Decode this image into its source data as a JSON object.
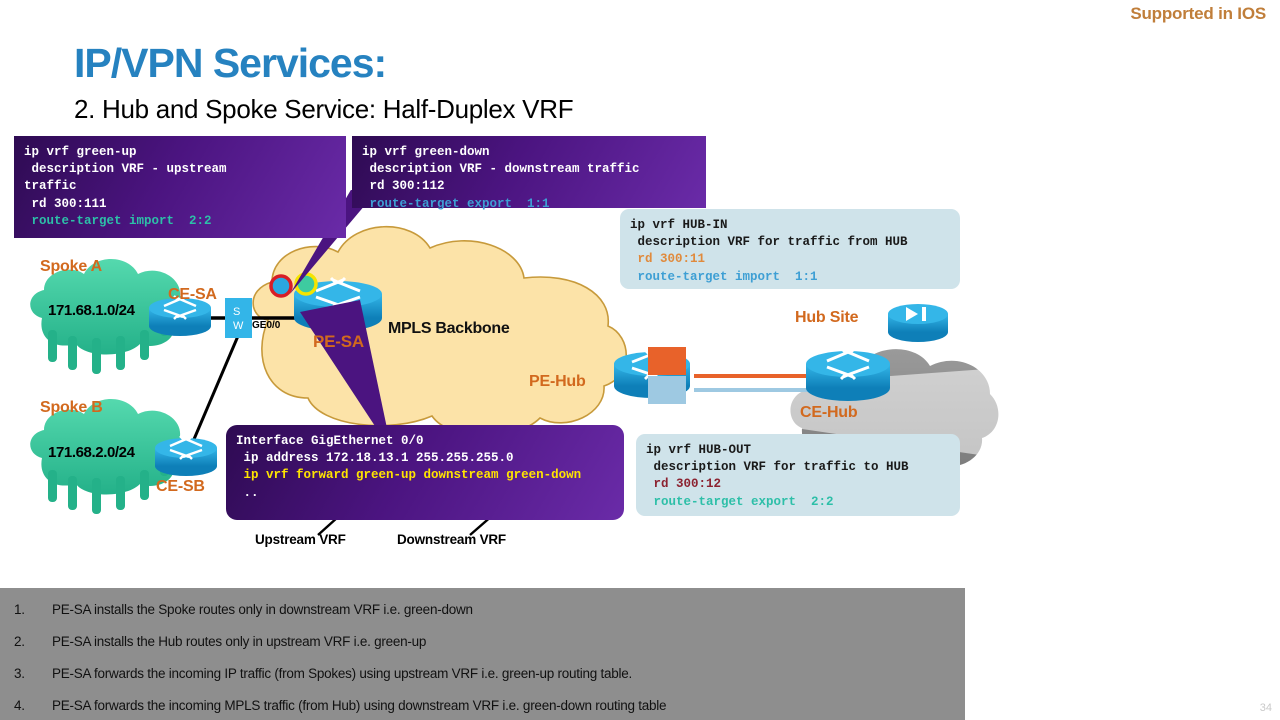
{
  "header": {
    "supported_label": "Supported in IOS",
    "title": "IP/VPN Services:",
    "subtitle": "2. Hub and Spoke Service: Half-Duplex VRF",
    "accent_title_color": "#2682C0",
    "accent_supported_color": "#C07E3A"
  },
  "code_boxes": {
    "green_up": {
      "name": "ip vrf green-up",
      "lines": [
        "ip vrf green-up",
        " description VRF - upstream",
        "traffic",
        " rd 300:111",
        " route-target import  2:2"
      ],
      "line1": "ip vrf green-up",
      "line2": " description VRF - upstream",
      "line3": "traffic",
      "line4": " rd 300:111",
      "line5": " route-target import  2:2"
    },
    "green_down": {
      "line1": "ip vrf green-down",
      "line2": " description VRF - downstream traffic",
      "line3": " rd 300:112",
      "line4": " route-target export  1:1"
    },
    "hub_in": {
      "line1": "ip vrf HUB-IN",
      "line2": " description VRF for traffic from HUB",
      "line3": " rd 300:11",
      "line4": " route-target import  1:1"
    },
    "hub_out": {
      "line1": "ip vrf HUB-OUT",
      "line2": " description VRF for traffic to HUB",
      "line3": " rd 300:12",
      "line4": " route-target export  2:2"
    },
    "interface": {
      "line1": "Interface GigEthernet 0/0",
      "line2": " ip address 172.18.13.1 255.255.255.0",
      "line3a": " ip vrf forward ",
      "line3b": "green-up",
      "line3c": " downstream ",
      "line3d": "green-down",
      "line4": " .."
    }
  },
  "diagram": {
    "spoke_a_label": "Spoke A",
    "spoke_a_network": "171.68.1.0/24",
    "spoke_b_label": "Spoke B",
    "spoke_b_network": "171.68.2.0/24",
    "ce_sa_label": "CE-SA",
    "ce_sb_label": "CE-SB",
    "switch_label_s": "S",
    "switch_label_w": "W",
    "interface_label": "GE0/0",
    "pe_sa_label": "PE-SA",
    "pe_hub_label": "PE-Hub",
    "mpls_label": "MPLS Backbone",
    "hub_site_label": "Hub Site",
    "ce_hub_label": "CE-Hub",
    "upstream_vrf_label": "Upstream VRF",
    "downstream_vrf_label": "Downstream VRF",
    "colors": {
      "spoke_cloud": "#3ECBA0",
      "mpls_cloud": "#FCE3A8",
      "hub_cloud": "#8A8A8A",
      "router_blue": "#1B9AD6",
      "orange_link": "#E8622A",
      "blue_link": "#9EC9E2",
      "marker_red": "#D81E26",
      "marker_yellow": "#F5E400"
    }
  },
  "bullets": [
    {
      "num": "1.",
      "text": "PE-SA installs the Spoke routes only in downstream VRF i.e. green-down"
    },
    {
      "num": "2.",
      "text": "PE-SA installs the Hub routes only in upstream VRF i.e. green-up"
    },
    {
      "num": "3.",
      "text": "PE-SA forwards the incoming IP traffic (from Spokes) using upstream VRF i.e. green-up routing table."
    },
    {
      "num": "4.",
      "text": "PE-SA forwards the incoming MPLS traffic (from Hub) using downstream VRF i.e. green-down routing table"
    }
  ],
  "footer": {
    "page_number": "34"
  }
}
